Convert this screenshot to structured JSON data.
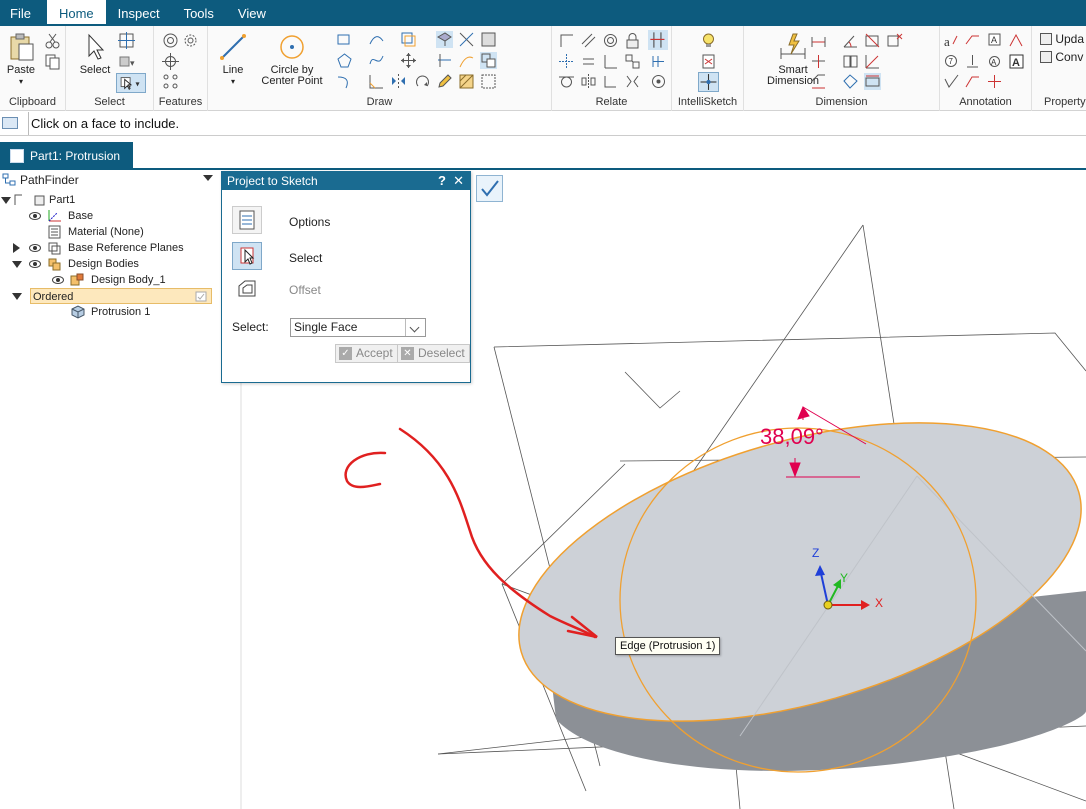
{
  "menubar": {
    "tabs": [
      {
        "label": "File"
      },
      {
        "label": "Home"
      },
      {
        "label": "Inspect"
      },
      {
        "label": "Tools"
      },
      {
        "label": "View"
      }
    ],
    "active": "Home",
    "accent_color": "#0d5b7e"
  },
  "ribbon": {
    "groups": {
      "clipboard": "Clipboard",
      "select": "Select",
      "features": "Features",
      "draw": "Draw",
      "relate": "Relate",
      "intellisketch": "IntelliSketch",
      "dimension": "Dimension",
      "annotation": "Annotation",
      "properties": "Property"
    },
    "buttons": {
      "paste": "Paste",
      "select": "Select",
      "line": "Line",
      "circle_line1": "Circle by",
      "circle_line2": "Center Point",
      "smart_dim_line1": "Smart",
      "smart_dim_line2": "Dimension",
      "update": "Upda",
      "convert": "Conv"
    }
  },
  "prompt": {
    "text": "Click on a face to include."
  },
  "doc_tab": {
    "label": "Part1: Protrusion"
  },
  "pathfinder": {
    "title": "PathFinder",
    "items": [
      {
        "label": "Part1"
      },
      {
        "label": "Base"
      },
      {
        "label": "Material (None)"
      },
      {
        "label": "Base Reference Planes"
      },
      {
        "label": "Design Bodies"
      },
      {
        "label": "Design Body_1"
      },
      {
        "label": "Ordered"
      },
      {
        "label": "Protrusion 1"
      }
    ]
  },
  "dialog": {
    "title": "Project to Sketch",
    "help": "?",
    "close": "✕",
    "options_label": "Options",
    "select_label": "Select",
    "offset_label": "Offset",
    "select_field_label": "Select:",
    "select_value": "Single Face",
    "accept_label": "Accept",
    "deselect_label": "Deselect"
  },
  "canvas": {
    "angle_text": "38,09°",
    "tooltip": "Edge (Protrusion 1)",
    "axis_x": "X",
    "axis_y": "Y",
    "axis_z": "Z",
    "annotation_color": "#e02020",
    "dimension_color": "#e0004f",
    "highlight_color": "#f0a030"
  }
}
